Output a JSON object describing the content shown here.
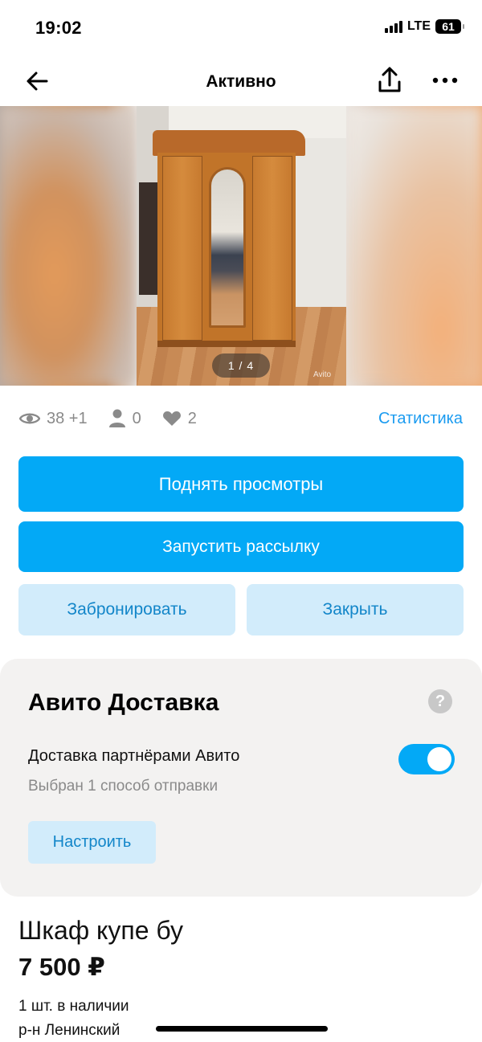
{
  "status_bar": {
    "time": "19:02",
    "network": "LTE",
    "battery": "61"
  },
  "nav": {
    "title": "Активно",
    "back_icon": "arrow-left-icon",
    "share_icon": "share-icon",
    "more_icon": "more-horizontal-icon"
  },
  "gallery": {
    "counter": "1 / 4",
    "watermark": "Avito"
  },
  "stats": {
    "views": "38 +1",
    "contacts": "0",
    "favorites": "2",
    "link": "Статистика"
  },
  "actions": {
    "raise_views": "Поднять просмотры",
    "start_mailing": "Запустить рассылку",
    "book": "Забронировать",
    "close": "Закрыть"
  },
  "delivery": {
    "title": "Авито Доставка",
    "help": "?",
    "option_label": "Доставка партнёрами Авито",
    "option_sub": "Выбран 1 способ отправки",
    "enabled": true,
    "configure": "Настроить"
  },
  "listing": {
    "title": "Шкаф купе бу",
    "price": "7 500 ₽",
    "stock": "1 шт. в наличии",
    "district": "р-н Ленинский"
  },
  "colors": {
    "accent": "#03a9f6",
    "secondary_bg": "#d2ecfb",
    "secondary_text": "#1386c9",
    "link": "#1a9bf0"
  }
}
